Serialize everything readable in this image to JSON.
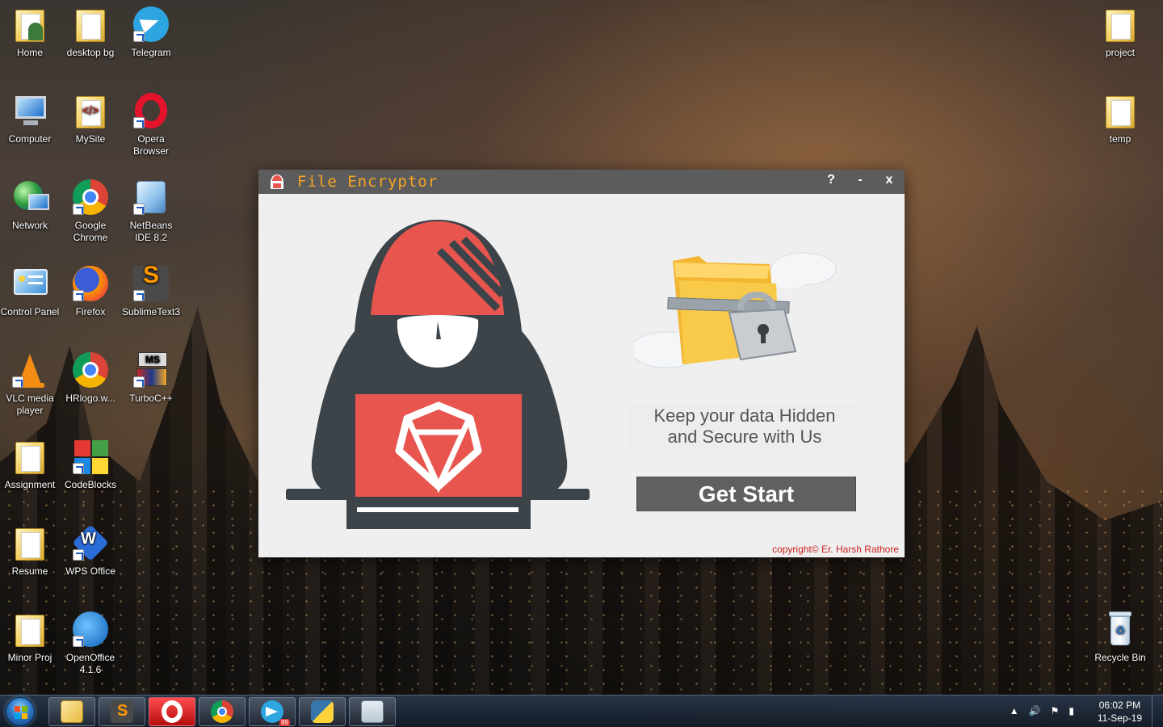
{
  "desktop": {
    "icons": [
      {
        "id": "home",
        "label": "Home"
      },
      {
        "id": "desktop-bg",
        "label": "desktop bg"
      },
      {
        "id": "telegram",
        "label": "Telegram"
      },
      {
        "id": "computer",
        "label": "Computer"
      },
      {
        "id": "mysite",
        "label": "MySite"
      },
      {
        "id": "opera",
        "label": "Opera Browser"
      },
      {
        "id": "network",
        "label": "Network"
      },
      {
        "id": "chrome",
        "label": "Google Chrome"
      },
      {
        "id": "netbeans",
        "label": "NetBeans IDE 8.2"
      },
      {
        "id": "control-panel",
        "label": "Control Panel"
      },
      {
        "id": "firefox",
        "label": "Firefox"
      },
      {
        "id": "sublime",
        "label": "SublimeText3"
      },
      {
        "id": "vlc",
        "label": "VLC media player"
      },
      {
        "id": "hrlogo",
        "label": "HRlogo.w..."
      },
      {
        "id": "turbocpp",
        "label": "TurboC++"
      },
      {
        "id": "assignment",
        "label": "Assignment"
      },
      {
        "id": "codeblocks",
        "label": "CodeBlocks"
      },
      {
        "id": "resume",
        "label": "Resume"
      },
      {
        "id": "wps",
        "label": "WPS Office"
      },
      {
        "id": "minor-proj",
        "label": "Minor Proj"
      },
      {
        "id": "openoffice",
        "label": "OpenOffice 4.1.6"
      },
      {
        "id": "project",
        "label": "project"
      },
      {
        "id": "temp",
        "label": "temp"
      },
      {
        "id": "recycle-bin",
        "label": "Recycle Bin"
      }
    ]
  },
  "window": {
    "title": "File Encryptor",
    "help_label": "?",
    "minimize_label": "-",
    "close_label": "x",
    "tagline_line1": "Keep your data Hidden",
    "tagline_line2": "and Secure with Us",
    "start_button": "Get Start",
    "copyright": "copyright© Er. Harsh Rathore",
    "colors": {
      "accent": "#f5a623",
      "hood": "#3d4449",
      "red": "#e8554e",
      "button": "#606060"
    }
  },
  "taskbar": {
    "apps": [
      "file-explorer",
      "sublime-text",
      "opera",
      "chrome",
      "telegram",
      "python",
      "calculator"
    ],
    "telegram_badge": "89",
    "time": "06:02 PM",
    "date": "11-Sep-19"
  }
}
